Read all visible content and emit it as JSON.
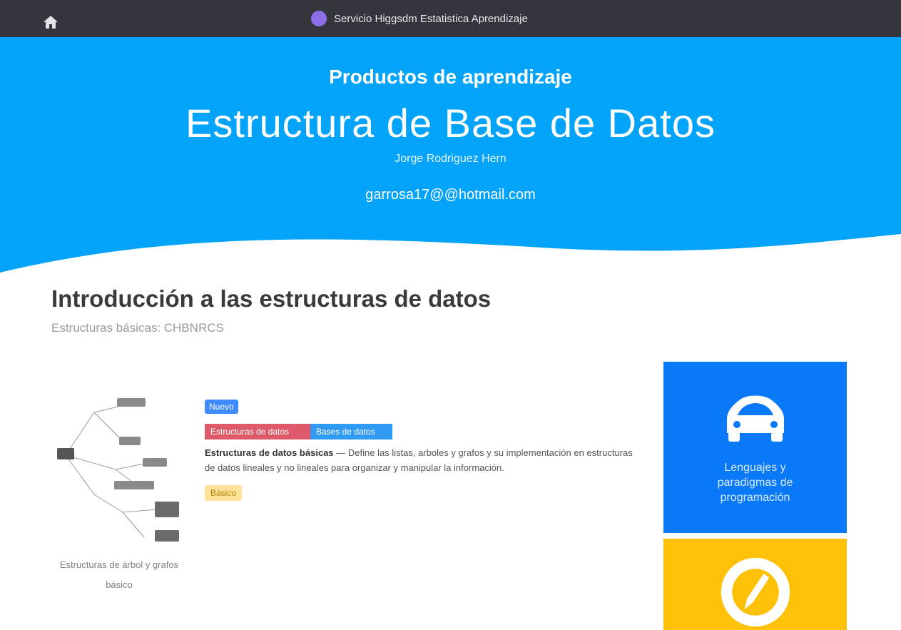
{
  "topbar": {
    "title": "Servicio Higgsdm Estatistica Aprendizaje"
  },
  "hero": {
    "kicker": "Productos de aprendizaje",
    "title": "Estructura de Base de Datos",
    "author": "Jorge Rodriguez Hern",
    "email": "garrosa17@@hotmail.com"
  },
  "section": {
    "title": "Introducción a las estructuras de datos",
    "subtitle": "Estructuras básicas: CHBNRCS"
  },
  "thumbnail": {
    "caption_line1": "Estructuras de árbol y grafos",
    "caption_line2": "básico"
  },
  "card": {
    "badge_new": "Nuevo",
    "tag_a": "Estructuras de datos",
    "tag_b": "Bases de datos",
    "description_bold": "Estructuras de datos básicas",
    "description": "— Define las listas, arboles y grafos y su implementación en estructuras de datos lineales y no lineales para organizar y manipular la información.",
    "level": "Básico"
  },
  "tiles": {
    "blue_label": "Lenguajes y paradigmas de programación",
    "blue_icon": "car-icon",
    "yellow_icon": "pencil-icon"
  },
  "colors": {
    "topbar": "#34363d",
    "hero": "#02a3f8",
    "tile_blue": "#0a79f8",
    "tile_yellow": "#ffc107"
  }
}
